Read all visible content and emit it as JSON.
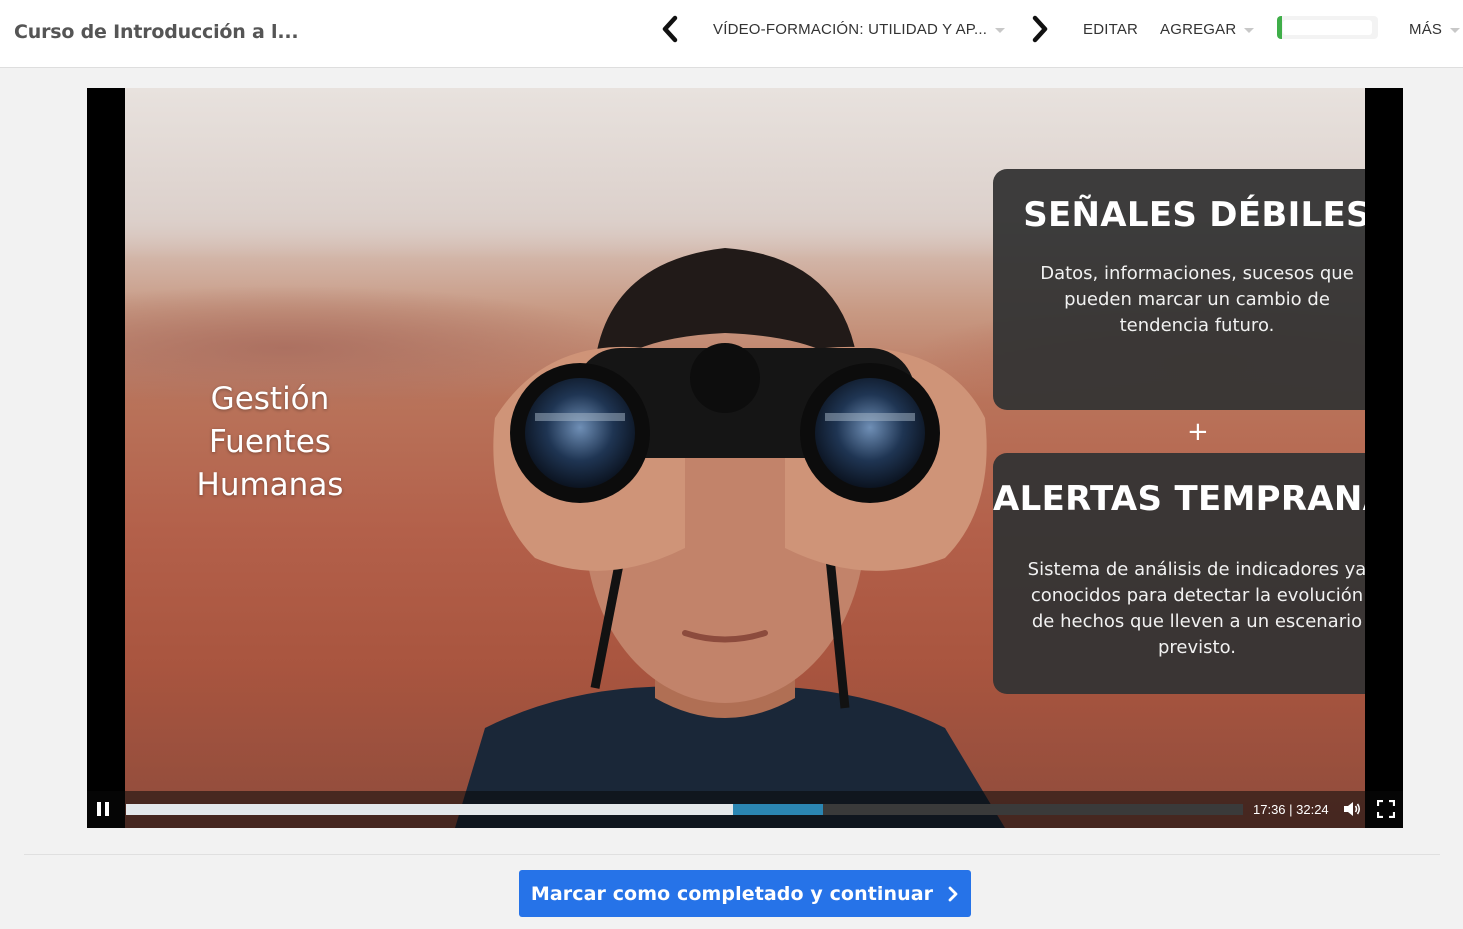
{
  "header": {
    "course_title": "Curso de Introducción a l...",
    "lesson_title": "VÍDEO-FORMACIÓN: UTILIDAD Y AP...",
    "edit_label": "EDITAR",
    "add_label": "AGREGAR",
    "more_label": "MÁS",
    "progress_fraction": 0.05,
    "accent_green": "#3fae49"
  },
  "video": {
    "slide_left_lines": [
      "Gestión",
      "Fuentes",
      "Humanas"
    ],
    "card1": {
      "title": "SEÑALES DÉBILES",
      "body": "Datos, informaciones, sucesos que pueden marcar un cambio de tendencia futuro."
    },
    "plus": "+",
    "card2": {
      "title": "ALERTAS TEMPRANAS",
      "body": "Sistema de análisis de indicadores ya conocidos para detectar la evolución de hechos que lleven a un escenario previsto."
    },
    "time_display": "17:36 | 32:24",
    "played_fraction": 0.543,
    "buffered_fraction": 0.624,
    "buffer_color": "#2b86b3"
  },
  "footer": {
    "complete_button_label": "Marcar como completado y continuar",
    "button_color": "#2673e8"
  },
  "icons": [
    "chevron-left-icon",
    "chevron-right-icon",
    "caret-down-icon",
    "pause-icon",
    "volume-icon",
    "fullscreen-icon",
    "chevron-right-icon"
  ]
}
